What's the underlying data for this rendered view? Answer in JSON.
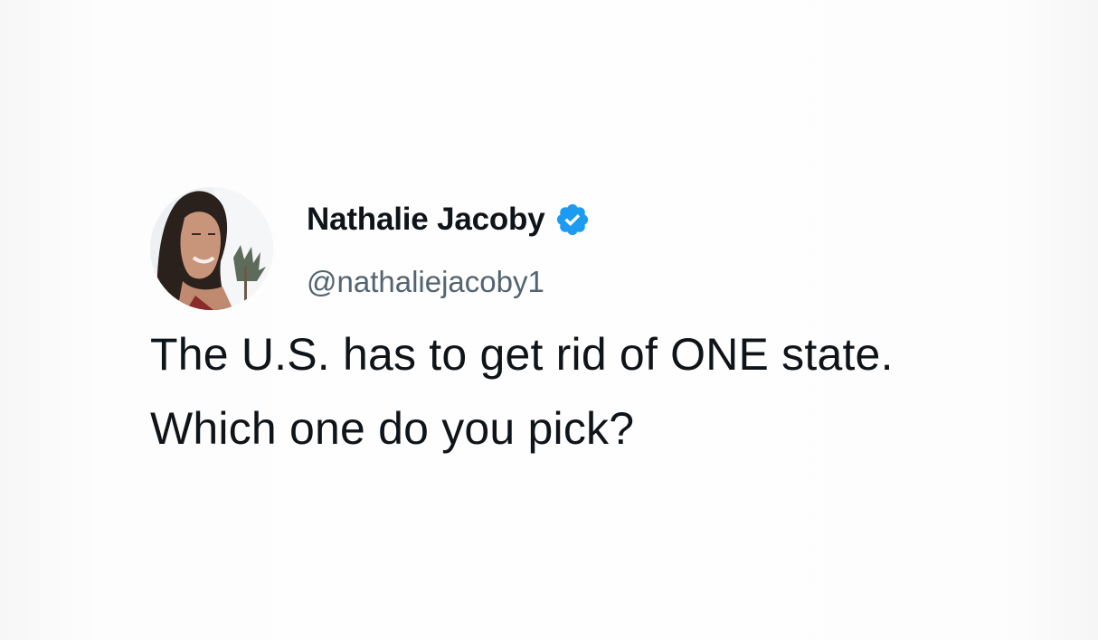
{
  "tweet": {
    "author": {
      "display_name": "Nathalie Jacoby",
      "handle": "@nathaliejacoby1",
      "verified": true,
      "avatar_icon": "profile-photo-avatar",
      "verified_icon": "verified-badge-icon"
    },
    "text": "The U.S. has to get rid of ONE state. Which one do you pick?"
  },
  "colors": {
    "background": "#fcfcfc",
    "text": "#0f1419",
    "secondary_text": "#536471",
    "verified_badge": "#1d9bf0"
  }
}
